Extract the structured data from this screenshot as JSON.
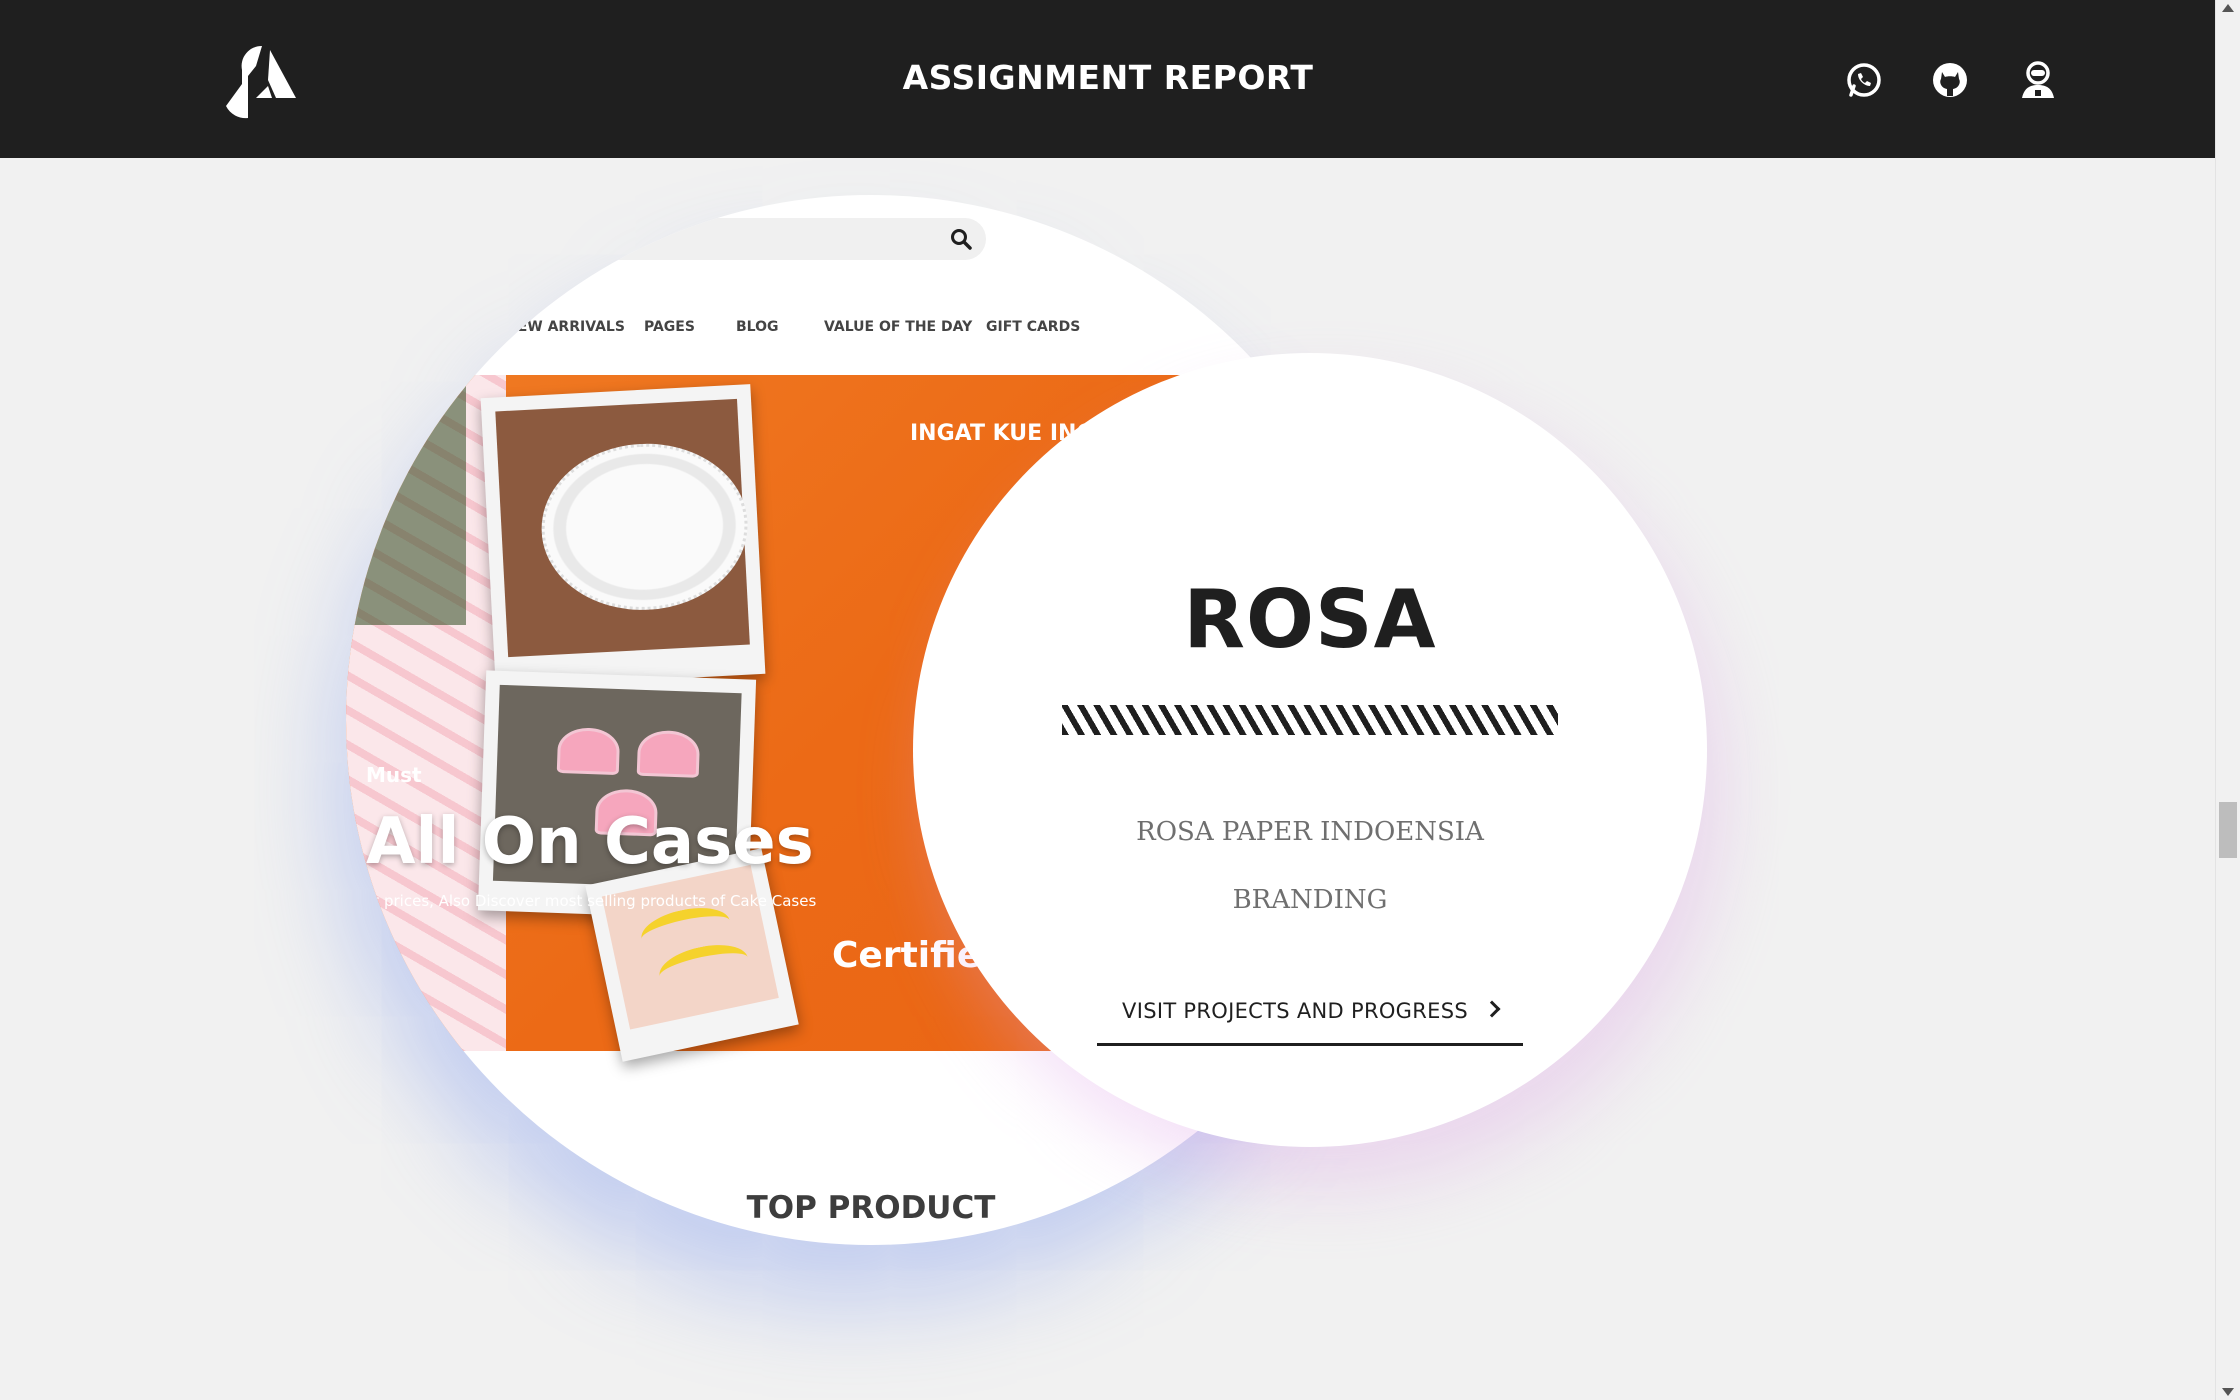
{
  "header": {
    "title": "ASSIGNMENT REPORT",
    "icons": [
      "whatsapp-icon",
      "github-icon",
      "profile-icon"
    ],
    "background": "#1f1f1f"
  },
  "preview": {
    "nav_items": [
      "NEW ARRIVALS",
      "PAGES",
      "BLOG",
      "VALUE OF THE DAY",
      "GIFT CARDS"
    ],
    "banner_heading": "All On Cases",
    "banner_eyebrow": "Must",
    "banner_subtext": "Best prices, Also Discover most selling products of Cake Cases",
    "sticker_top": "INGAT KUE INGAT",
    "sticker_bottom": "Certified",
    "section_title": "TOP PRODUCT",
    "accent": "#ec6a16"
  },
  "project": {
    "title": "ROSA",
    "company": "ROSA PAPER INDOENSIA",
    "category": "BRANDING",
    "link_label": "VISIT PROJECTS AND PROGRESS"
  }
}
